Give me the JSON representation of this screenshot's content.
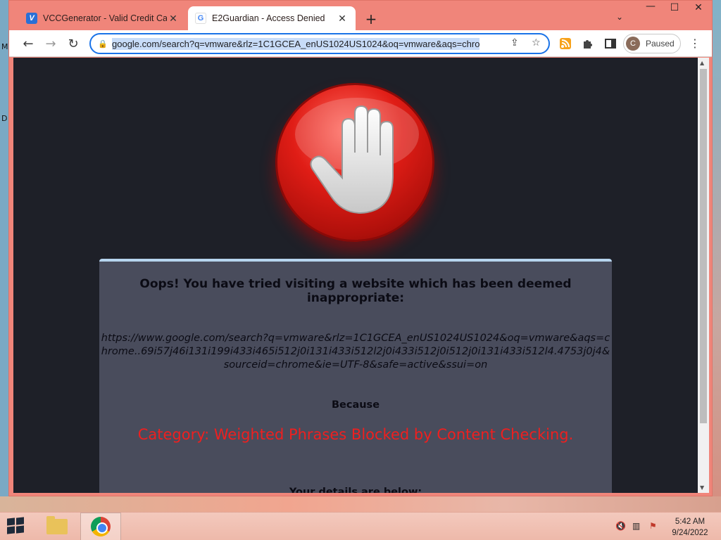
{
  "desktop": {
    "left_glyphs": [
      "M",
      "D"
    ]
  },
  "browser": {
    "tabs": [
      {
        "title": "VCCGenerator - Valid Credit Card",
        "favicon": "V",
        "active": false
      },
      {
        "title": "E2Guardian - Access Denied",
        "favicon": "G",
        "active": true
      }
    ],
    "new_tab_glyph": "+",
    "tab_list_glyph": "⌄",
    "window_controls": {
      "minimize": "—",
      "maximize": "☐",
      "close": "✕"
    },
    "toolbar": {
      "back_glyph": "←",
      "forward_glyph": "→",
      "reload_glyph": "↻",
      "url": "google.com/search?q=vmware&rlz=1C1GCEA_enUS1024US1024&oq=vmware&aqs=chro",
      "share_glyph": "⇪",
      "star_glyph": "☆",
      "profile_initial": "C",
      "profile_status": "Paused",
      "menu_glyph": "⋮"
    }
  },
  "page": {
    "heading": "Oops! You have tried visiting a website which has been deemed inappropriate:",
    "blocked_url": "https://www.google.com/search?q=vmware&rlz=1C1GCEA_enUS1024US1024&oq=vmware&aqs=chrome..69i57j46i131i199i433i465i512j0i131i433i512l2j0i433i512j0i512j0i131i433i512l4.4753j0j4&sourceid=chrome&ie=UTF-8&safe=active&ssui=on",
    "because_label": "Because",
    "reason": "Category: Weighted Phrases  Blocked by Content Checking.",
    "details_label": "Your details are below:"
  },
  "taskbar": {
    "tray": {
      "volume_glyph": "🔇",
      "network_glyph": "▥",
      "flag_glyph": "⚑"
    },
    "time": "5:42 AM",
    "date": "9/24/2022"
  },
  "colors": {
    "window_frame": "#f0857a",
    "page_background": "#1e2028",
    "panel_background": "#494c5c",
    "reason_text": "#ef1f1f",
    "omnibox_focus": "#1a73e8"
  }
}
